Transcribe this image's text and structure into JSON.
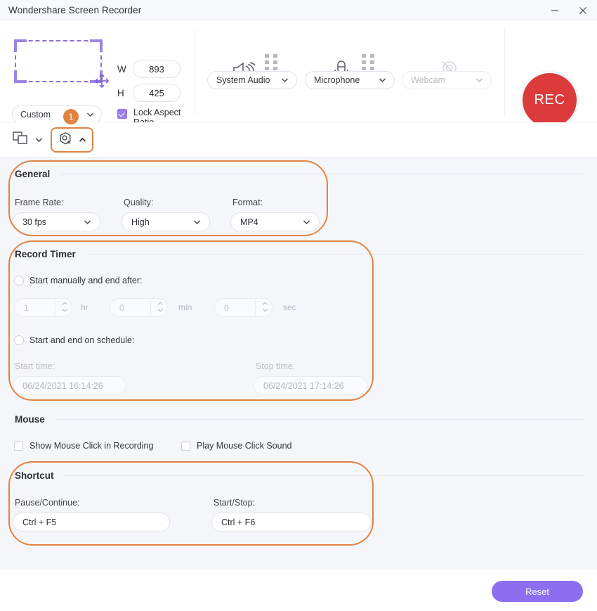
{
  "window": {
    "title": "Wondershare Screen Recorder",
    "minimize_label": "minimize",
    "close_label": "close"
  },
  "capture": {
    "region_icon": "capture-region-icon",
    "move_icon": "move-cursor-icon",
    "preset": "Custom",
    "width_label": "W",
    "width_value": "893",
    "height_label": "H",
    "height_value": "425",
    "lock_aspect_label": "Lock Aspect Ratio",
    "lock_aspect_checked": true
  },
  "audio": {
    "system": {
      "icon": "speaker-icon",
      "label": "System Audio",
      "enabled": true
    },
    "microphone": {
      "icon": "microphone-icon",
      "label": "Microphone",
      "enabled": true
    },
    "webcam": {
      "icon": "webcam-off-icon",
      "label": "Webcam",
      "enabled": false
    }
  },
  "record_button": {
    "label": "REC",
    "color": "#dc3b3b"
  },
  "toolstrip": {
    "screen_tool_icon": "screen-window-icon",
    "settings_tool_icon": "settings-gear-icon",
    "badge": "1",
    "highlight_color": "#e08342"
  },
  "general": {
    "heading": "General",
    "frame_rate_label": "Frame Rate:",
    "frame_rate_value": "30 fps",
    "quality_label": "Quality:",
    "quality_value": "High",
    "format_label": "Format:",
    "format_value": "MP4"
  },
  "record_timer": {
    "heading": "Record Timer",
    "manual_label": "Start manually and end after:",
    "manual_selected": false,
    "hours_value": "1",
    "hours_unit": "hr",
    "minutes_value": "0",
    "minutes_unit": "min",
    "seconds_value": "0",
    "seconds_unit": "sec",
    "schedule_label": "Start and end on schedule:",
    "schedule_selected": false,
    "start_time_label": "Start time:",
    "start_time_value": "06/24/2021 16:14:26",
    "stop_time_label": "Stop time:",
    "stop_time_value": "06/24/2021 17:14:26"
  },
  "mouse": {
    "heading": "Mouse",
    "show_click_label": "Show Mouse Click in Recording",
    "show_click_checked": false,
    "click_sound_label": "Play Mouse Click Sound",
    "click_sound_checked": false
  },
  "shortcut": {
    "heading": "Shortcut",
    "pause_label": "Pause/Continue:",
    "pause_value": "Ctrl + F5",
    "startstop_label": "Start/Stop:",
    "startstop_value": "Ctrl + F6"
  },
  "footer": {
    "reset_label": "Reset",
    "reset_color": "#8b6ff0"
  }
}
